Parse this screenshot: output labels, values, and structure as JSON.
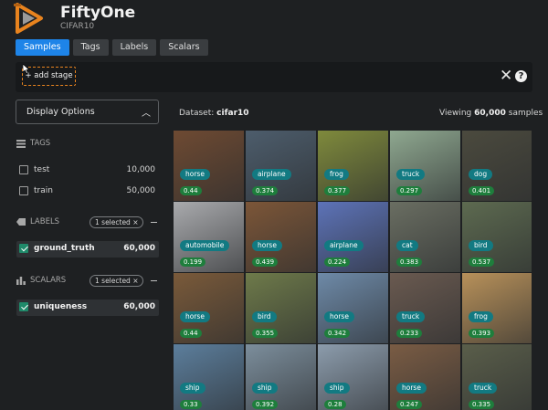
{
  "app": {
    "title": "FiftyOne",
    "subtitle": "CIFAR10"
  },
  "tabs": [
    {
      "label": "Samples",
      "active": true
    },
    {
      "label": "Tags",
      "active": false
    },
    {
      "label": "Labels",
      "active": false
    },
    {
      "label": "Scalars",
      "active": false
    }
  ],
  "stage_bar": {
    "add_stage_label": "+ add stage",
    "close_icon": "close-icon",
    "help_icon": "help-icon",
    "help_glyph": "?"
  },
  "display_options": {
    "label": "Display Options",
    "caret": "^"
  },
  "sidebar": {
    "tags": {
      "header": "TAGS",
      "items": [
        {
          "label": "test",
          "count": "10,000",
          "checked": false
        },
        {
          "label": "train",
          "count": "50,000",
          "checked": false
        }
      ]
    },
    "labels": {
      "header": "LABELS",
      "selected_pill": "1 selected ×",
      "items": [
        {
          "label": "ground_truth",
          "count": "60,000",
          "checked": true
        }
      ]
    },
    "scalars": {
      "header": "SCALARS",
      "selected_pill": "1 selected ×",
      "items": [
        {
          "label": "uniqueness",
          "count": "60,000",
          "checked": true
        }
      ]
    }
  },
  "main": {
    "dataset_prefix": "Dataset:",
    "dataset_name": "cifar10",
    "viewing_prefix": "Viewing",
    "viewing_count": "60,000",
    "viewing_suffix": "samples"
  },
  "samples": [
    {
      "label": "horse",
      "score": "0.44",
      "color": "#6e4a32"
    },
    {
      "label": "airplane",
      "score": "0.374",
      "color": "#4d5d6c"
    },
    {
      "label": "frog",
      "score": "0.377",
      "color": "#7f8a3c"
    },
    {
      "label": "truck",
      "score": "0.297",
      "color": "#8fa890"
    },
    {
      "label": "dog",
      "score": "0.401",
      "color": "#4b4a3e"
    },
    {
      "label": "automobile",
      "score": "0.199",
      "color": "#a9aaad"
    },
    {
      "label": "horse",
      "score": "0.439",
      "color": "#7c5638"
    },
    {
      "label": "airplane",
      "score": "0.224",
      "color": "#5d73b8"
    },
    {
      "label": "cat",
      "score": "0.383",
      "color": "#6a6e62"
    },
    {
      "label": "bird",
      "score": "0.537",
      "color": "#5d6a50"
    },
    {
      "label": "horse",
      "score": "0.44",
      "color": "#7a5a3a"
    },
    {
      "label": "bird",
      "score": "0.355",
      "color": "#6e7a4a"
    },
    {
      "label": "horse",
      "score": "0.342",
      "color": "#6e8aa8"
    },
    {
      "label": "truck",
      "score": "0.233",
      "color": "#6a5a50"
    },
    {
      "label": "frog",
      "score": "0.393",
      "color": "#b8915a"
    },
    {
      "label": "ship",
      "score": "0.33",
      "color": "#5c7e9c"
    },
    {
      "label": "ship",
      "score": "0.392",
      "color": "#7c8e9c"
    },
    {
      "label": "ship",
      "score": "0.28",
      "color": "#8c9cac"
    },
    {
      "label": "horse",
      "score": "0.247",
      "color": "#7a5c44"
    },
    {
      "label": "truck",
      "score": "0.335",
      "color": "#5a5e4a"
    }
  ]
}
